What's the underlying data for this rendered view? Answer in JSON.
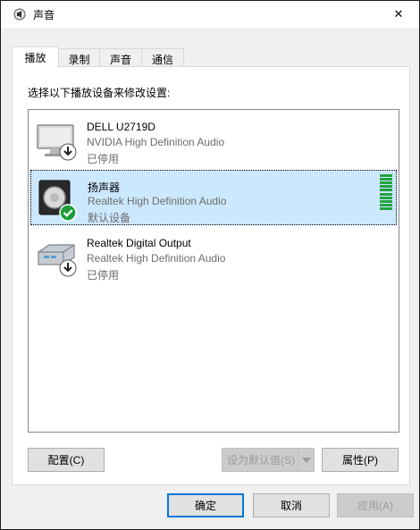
{
  "window": {
    "title": "声音",
    "close_glyph": "✕"
  },
  "tabs": [
    {
      "label": "播放",
      "active": true
    },
    {
      "label": "录制",
      "active": false
    },
    {
      "label": "声音",
      "active": false
    },
    {
      "label": "通信",
      "active": false
    }
  ],
  "panel": {
    "instruction": "选择以下播放设备来修改设置:"
  },
  "devices": [
    {
      "name": "DELL U2719D",
      "description": "NVIDIA High Definition Audio",
      "status": "已停用",
      "icon": "monitor-icon",
      "badge": "down-arrow-badge",
      "selected": false
    },
    {
      "name": "扬声器",
      "description": "Realtek High Definition Audio",
      "status": "默认设备",
      "icon": "speaker-icon",
      "badge": "green-check-badge",
      "selected": true,
      "level_bars": 10
    },
    {
      "name": "Realtek Digital Output",
      "description": "Realtek High Definition Audio",
      "status": "已停用",
      "icon": "digital-output-icon",
      "badge": "down-arrow-badge",
      "selected": false
    }
  ],
  "buttons": {
    "configure": "配置(C)",
    "set_default": "设为默认值(S)",
    "properties": "属性(P)",
    "ok": "确定",
    "cancel": "取消",
    "apply": "应用(A)"
  },
  "colors": {
    "selection": "#cce8ff",
    "accent": "#0078d7",
    "level": "#23a33f"
  }
}
